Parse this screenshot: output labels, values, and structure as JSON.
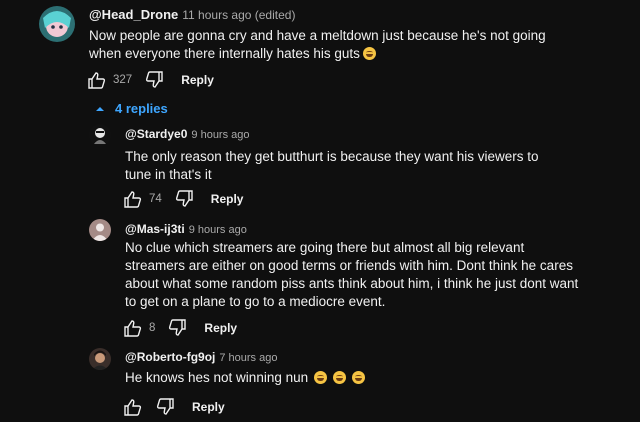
{
  "comments": [
    {
      "handle": "@Head_Drone",
      "time": "11 hours ago (edited)",
      "text": "Now people are gonna cry and have a meltdown just because he's not going when everyone there internally hates his guts",
      "likes": "327",
      "reply_label": "Reply",
      "emoji_count": 1
    }
  ],
  "replies_toggle": {
    "label": "4 replies",
    "icon": "caret-up-icon"
  },
  "replies": [
    {
      "handle": "@Stardye0",
      "time": "9 hours ago",
      "text": "The only reason they get butthurt is because they want his viewers to tune in that's it",
      "likes": "74",
      "reply_label": "Reply"
    },
    {
      "handle": "@Mas-ij3ti",
      "time": "9 hours ago",
      "text": "No clue which streamers are going there but almost all big relevant streamers are either on good terms or friends with him. Dont think he cares about what some random piss ants think about him, i think he just dont want to get on a plane to go to a mediocre event.",
      "likes": "8",
      "reply_label": "Reply"
    },
    {
      "handle": "@Roberto-fg9oj",
      "time": "7 hours ago",
      "text": "He knows hes not winning nun",
      "reply_label": "Reply",
      "emoji_count": 3
    }
  ],
  "colors": {
    "background": "#0f0f0f",
    "link": "#3ea6ff",
    "muted": "#aaaaaa"
  }
}
